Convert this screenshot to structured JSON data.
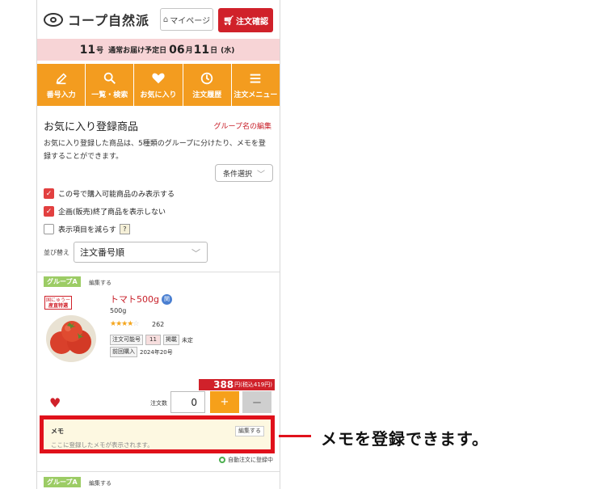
{
  "header": {
    "logo_text": "コープ自然派",
    "mypage_label": "マイページ",
    "order_confirm_label": "注文確認"
  },
  "delivery": {
    "issue_num": "11",
    "issue_unit": "号",
    "label": "通常お届け予定日",
    "date_month": "06",
    "month_unit": "月",
    "date_day": "11",
    "day_unit": "日",
    "weekday": "(水)"
  },
  "nav": [
    {
      "label": "番号入力",
      "icon": "pencil-icon"
    },
    {
      "label": "一覧・検索",
      "icon": "search-icon"
    },
    {
      "label": "お気に入り",
      "icon": "heart-icon"
    },
    {
      "label": "注文履歴",
      "icon": "clock-icon"
    },
    {
      "label": "注文メニュー",
      "icon": "menu-icon"
    }
  ],
  "page": {
    "title": "お気に入り登録商品",
    "group_edit_link": "グループ名の編集",
    "description": "お気に入り登録した商品は、5種類のグループに分けたり、メモを登録することができます。",
    "filter_button": "条件選択"
  },
  "checkboxes": [
    {
      "label": "この号で購入可能商品のみ表示する",
      "checked": true
    },
    {
      "label": "企画(販売)終了商品を表示しない",
      "checked": true
    },
    {
      "label": "表示項目を減らす",
      "checked": false
    }
  ],
  "help_mark": "?",
  "sort": {
    "label": "並び替え",
    "value": "注文番号順"
  },
  "product": {
    "group": "グループA",
    "group_edit": "編集する",
    "badge_line1": "国にゅうー",
    "badge_line2": "産直特選",
    "name": "トマト500g",
    "kanto_badge": "関",
    "size": "500g",
    "rating": 4,
    "review_count": "262",
    "order_num_label": "注文可能号",
    "order_num": "11",
    "posted_label": "掲載",
    "posted_value": "未定",
    "last_purchase_label": "前回購入",
    "last_purchase_value": "2024年20号",
    "price": "388",
    "price_tax": "円(税込419円)",
    "qty_label": "注文数",
    "qty_value": "0",
    "plus": "+",
    "minus": "－"
  },
  "memo": {
    "title": "メモ",
    "edit": "編集する",
    "placeholder": "ここに登録したメモが表示されます。"
  },
  "auto_order": "自動注文に登録中",
  "next_group": {
    "group": "グループA",
    "group_edit": "編集する"
  },
  "callout": "メモを登録できます。",
  "colors": {
    "accent_orange": "#f39c1f",
    "accent_red": "#d0212a",
    "delivery_bg": "#f7d4d6",
    "memo_bg": "#fdf8e1",
    "highlight_border": "#e0111b"
  }
}
